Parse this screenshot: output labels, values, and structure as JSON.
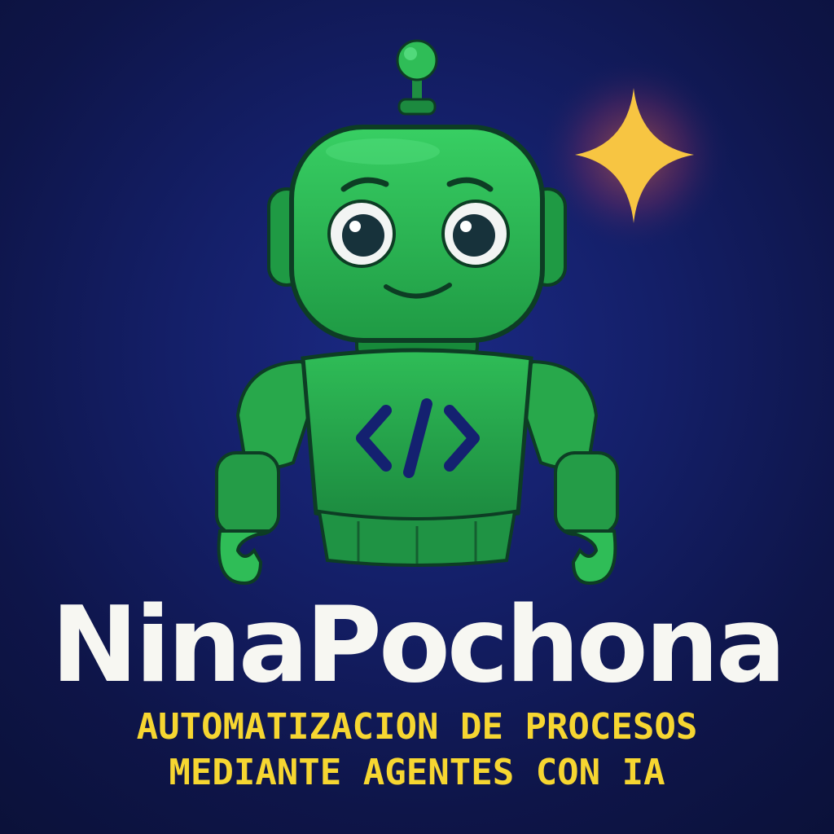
{
  "brand": {
    "title": "NinaPochona",
    "tagline_line1": "AUTOMATIZACION DE PROCESOS",
    "tagline_line2": "MEDIANTE AGENTES CON IA"
  },
  "illustration": {
    "subject": "robot-mascot",
    "chest_symbol": "</>",
    "accent_icon": "four-point-star-icon"
  },
  "colors": {
    "background": "#131d63",
    "robot_green": "#27a84a",
    "robot_highlight": "#3fd56a",
    "robot_shadow": "#16713a",
    "chest_code": "#142170",
    "star": "#f7c542",
    "title": "#f7f7f2",
    "tagline": "#f6d631"
  }
}
